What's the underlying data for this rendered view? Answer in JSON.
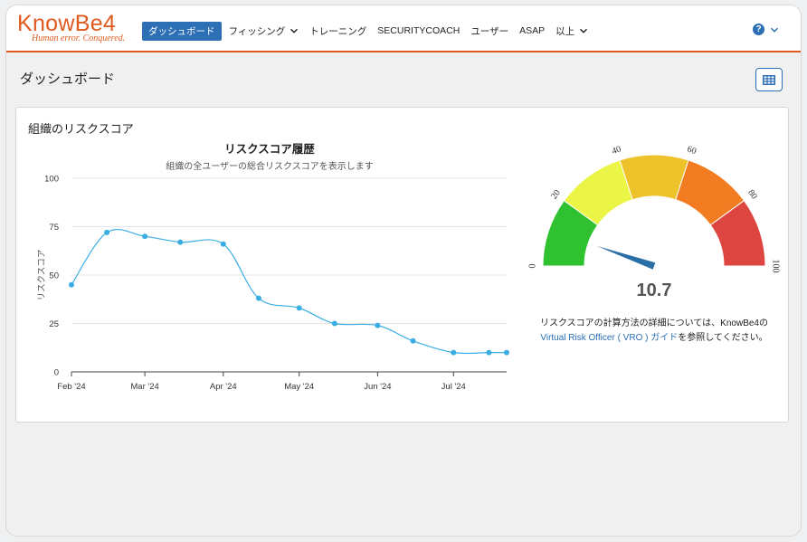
{
  "brand": {
    "name": "KnowBe4",
    "tagline": "Human error. Conquered.",
    "color": "#e05a1f"
  },
  "nav": {
    "items": [
      {
        "label": "ダッシュボード",
        "active": true
      },
      {
        "label": "フィッシング",
        "dropdown": true
      },
      {
        "label": "トレーニング"
      },
      {
        "label": "SECURITYCOACH"
      },
      {
        "label": "ユーザー"
      },
      {
        "label": "ASAP"
      },
      {
        "label": "以上",
        "dropdown": true
      }
    ],
    "help_icon": "question-circle-icon",
    "accent": "#2c6fb5"
  },
  "page": {
    "title": "ダッシュボード",
    "grid_button_icon": "grid-icon"
  },
  "panel": {
    "title": "組織のリスクスコア"
  },
  "chart_data": {
    "type": "line",
    "title": "リスクスコア履歴",
    "subtitle": "組織の全ユーザーの総合リスクスコアを表示します",
    "ylabel": "リスクスコア",
    "xlabel": "",
    "ylim": [
      0,
      100
    ],
    "yticks": [
      0,
      25,
      50,
      75,
      100
    ],
    "xticks": [
      "Feb '24",
      "Mar '24",
      "Apr '24",
      "May '24",
      "Jun '24",
      "Jul '24"
    ],
    "grid": true,
    "series": [
      {
        "color": "#3aaee3",
        "points": [
          {
            "x": "2024-02-01",
            "y": 45
          },
          {
            "x": "2024-02-15",
            "y": 72
          },
          {
            "x": "2024-03-01",
            "y": 70
          },
          {
            "x": "2024-03-15",
            "y": 67
          },
          {
            "x": "2024-04-01",
            "y": 66
          },
          {
            "x": "2024-04-15",
            "y": 38
          },
          {
            "x": "2024-05-01",
            "y": 33
          },
          {
            "x": "2024-05-15",
            "y": 25
          },
          {
            "x": "2024-06-01",
            "y": 24
          },
          {
            "x": "2024-06-15",
            "y": 16
          },
          {
            "x": "2024-07-01",
            "y": 10
          },
          {
            "x": "2024-07-15",
            "y": 10
          },
          {
            "x": "2024-07-22",
            "y": 10
          }
        ]
      }
    ]
  },
  "gauge": {
    "value": 10.7,
    "value_label": "10.7",
    "min": 0,
    "max": 100,
    "tick_labels": [
      "0",
      "20",
      "40",
      "60",
      "80",
      "100"
    ],
    "bands": [
      {
        "from": 0,
        "to": 20,
        "color": "#2fc12f"
      },
      {
        "from": 20,
        "to": 40,
        "color": "#eaf545"
      },
      {
        "from": 40,
        "to": 60,
        "color": "#edc22a"
      },
      {
        "from": 60,
        "to": 80,
        "color": "#f27c22"
      },
      {
        "from": 80,
        "to": 100,
        "color": "#dd4540"
      }
    ],
    "needle_color": "#2a6ea6"
  },
  "note": {
    "text_before": "リスクスコアの計算方法の詳細については、KnowBe4の",
    "link_text": "Virtual Risk Officer ( VRO ) ガイド",
    "text_after": "を参照してください。"
  }
}
